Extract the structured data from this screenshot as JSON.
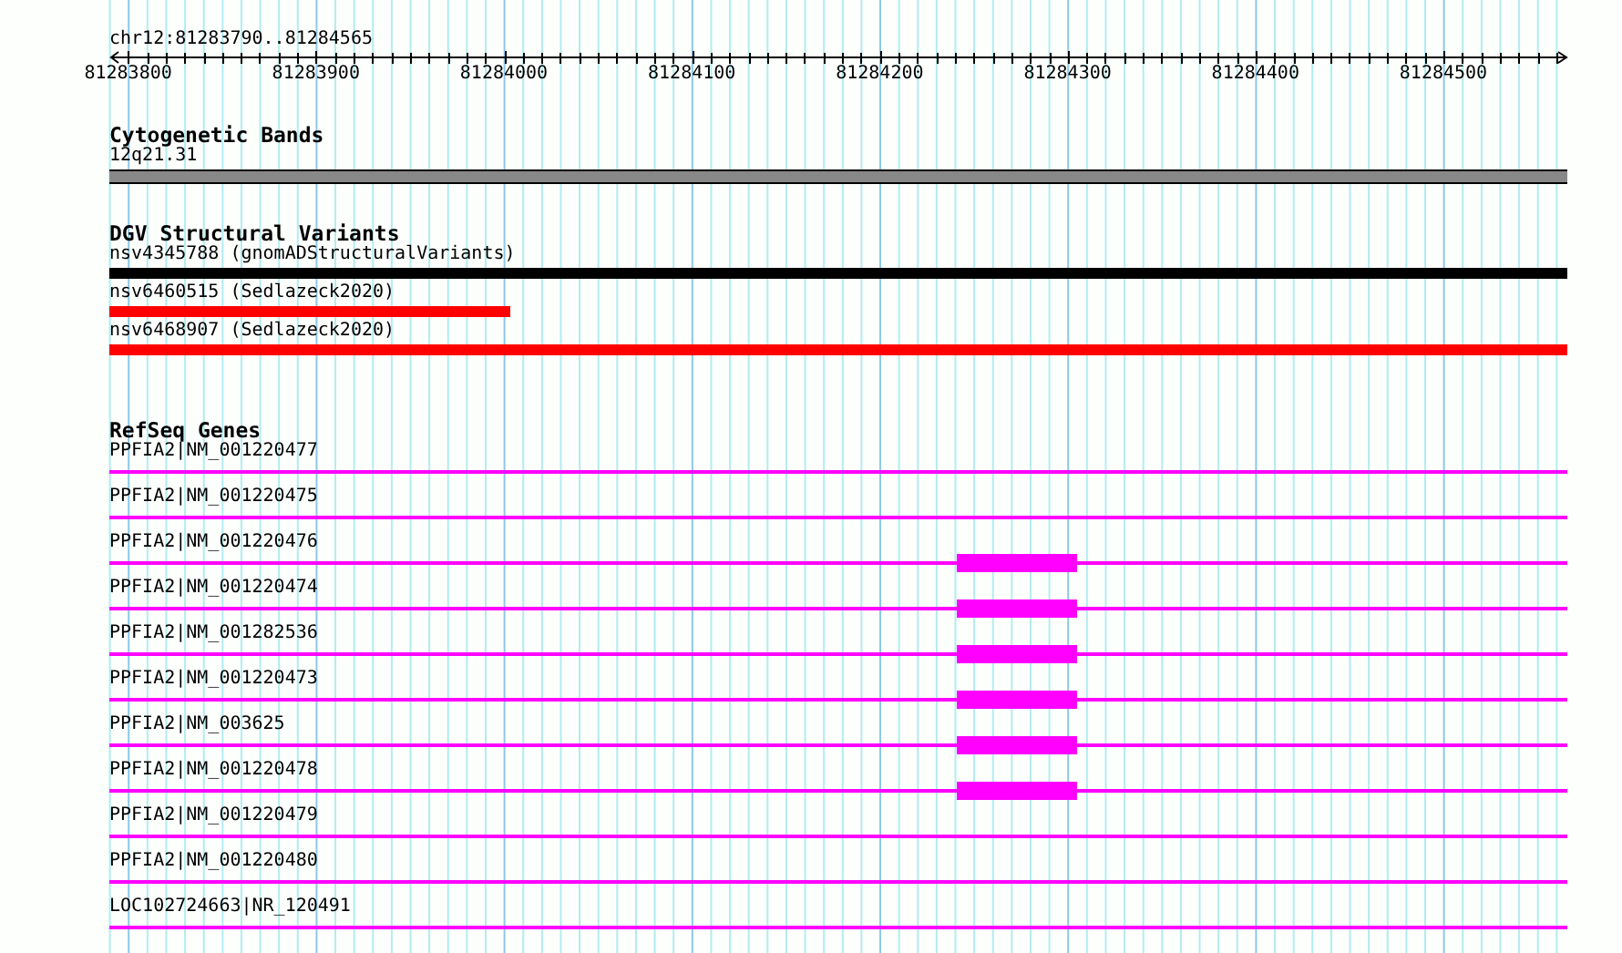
{
  "ruler": {
    "position_label": "chr12:81283790..81284565",
    "tick_labels": [
      "81283800",
      "81283900",
      "81284000",
      "81284100",
      "81284200",
      "81284300",
      "81284400",
      "81284500"
    ]
  },
  "tracks": [
    {
      "kind": "cytoband",
      "title": "Cytogenetic Bands",
      "items": [
        {
          "label": "12q21.31"
        }
      ]
    },
    {
      "kind": "variants",
      "title": "DGV Structural Variants",
      "items": [
        {
          "label": "nsv4345788 (gnomADStructuralVariants)",
          "color": "#000000",
          "level": 1
        },
        {
          "label": "nsv6460515 (Sedlazeck2020)",
          "color": "#ff0000",
          "level": 0.275
        },
        {
          "label": "nsv6468907 (Sedlazeck2020)",
          "color": "#ff0000",
          "level": 1
        }
      ]
    },
    {
      "kind": "genes",
      "title": "RefSeq Genes",
      "items": [
        {
          "label": "PPFIA2|NM_001220477",
          "kind": "line"
        },
        {
          "label": "PPFIA2|NM_001220475",
          "kind": "line"
        },
        {
          "label": "PPFIA2|NM_001220476",
          "kind": "exon"
        },
        {
          "label": "PPFIA2|NM_001220474",
          "kind": "exon"
        },
        {
          "label": "PPFIA2|NM_001282536",
          "kind": "exon"
        },
        {
          "label": "PPFIA2|NM_001220473",
          "kind": "exon"
        },
        {
          "label": "PPFIA2|NM_003625",
          "kind": "exon"
        },
        {
          "label": "PPFIA2|NM_001220478",
          "kind": "exon"
        },
        {
          "label": "PPFIA2|NM_001220479",
          "kind": "line"
        },
        {
          "label": "PPFIA2|NM_001220480",
          "kind": "line"
        },
        {
          "label": "LOC102724663|NR_120491",
          "kind": "line"
        }
      ]
    }
  ]
}
